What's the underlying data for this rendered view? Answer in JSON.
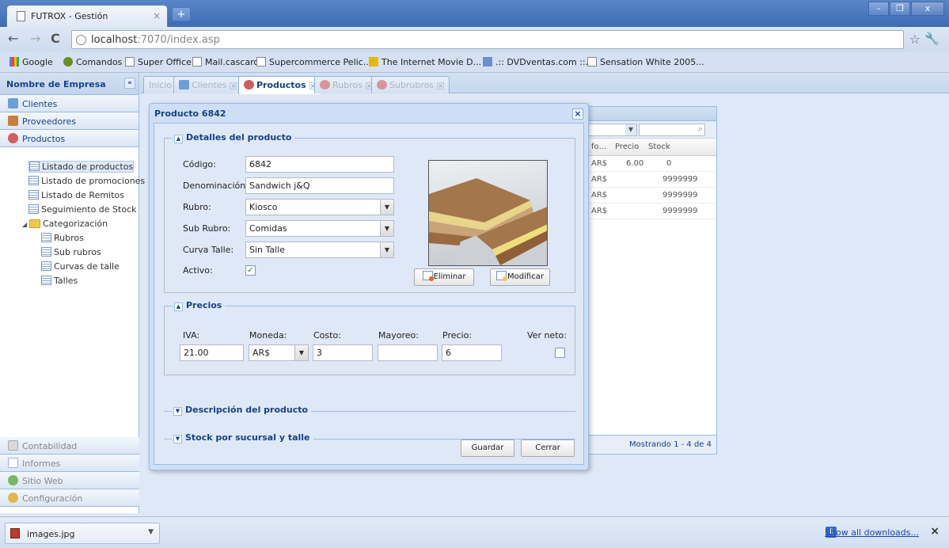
{
  "browser": {
    "tab_title": "FUTROX - Gestión",
    "tab_close": "×",
    "new_tab": "+",
    "url_host": "localhost",
    "url_rest": ":7070/index.asp",
    "window_min": "–",
    "window_max": "❐",
    "window_close": "x",
    "bookmarks": [
      "Google",
      "Comandos",
      "Super Office",
      "Mail.cascaro",
      "Supercommerce Pelic...",
      "The Internet Movie D...",
      ".:: DVDventas.com ::.",
      "Sensation White 2005..."
    ]
  },
  "sidebar": {
    "header": "Nombre de Empresa",
    "collapse": "«",
    "top_items": [
      "Clientes",
      "Proveedores",
      "Productos"
    ],
    "tree": [
      "Listado de productos",
      "Listado de promociones",
      "Listado de Remitos",
      "Seguimiento de Stock",
      "Categorización",
      "Rubros",
      "Sub rubros",
      "Curvas de talle",
      "Talles"
    ],
    "bottom_items": [
      "Contabilidad",
      "Informes",
      "Sitio Web",
      "Configuración"
    ]
  },
  "tabs": [
    "Inicio",
    "Clientes",
    "Productos",
    "Rubros",
    "Subrubros"
  ],
  "grid": {
    "headers": [
      "fo...",
      "Precio",
      "Stock"
    ],
    "rows": [
      {
        "moneda": "AR$",
        "precio": "6.00",
        "stock": "0"
      },
      {
        "moneda": "AR$",
        "precio": "",
        "stock": "9999999"
      },
      {
        "moneda": "AR$",
        "precio": "",
        "stock": "9999999"
      },
      {
        "moneda": "AR$",
        "precio": "",
        "stock": "9999999"
      }
    ],
    "footer": "Mostrando 1 - 4 de 4"
  },
  "dialog": {
    "title": "Producto 6842",
    "close": "×",
    "detalles": {
      "legend": "Detalles del producto",
      "codigo_label": "Código:",
      "codigo_value": "6842",
      "denominacion_label": "Denominación:",
      "denominacion_value": "Sandwich j&Q",
      "rubro_label": "Rubro:",
      "rubro_value": "Kiosco",
      "subrubro_label": "Sub Rubro:",
      "subrubro_value": "Comidas",
      "curva_label": "Curva Talle:",
      "curva_value": "Sin Talle",
      "activo_label": "Activo:",
      "activo_checked": true,
      "eliminar": "Eliminar",
      "modificar": "Modificar"
    },
    "precios": {
      "legend": "Precios",
      "iva_label": "IVA:",
      "iva_value": "21.00",
      "moneda_label": "Moneda:",
      "moneda_value": "AR$",
      "costo_label": "Costo:",
      "costo_value": "3",
      "mayoreo_label": "Mayoreo:",
      "mayoreo_value": "",
      "precio_label": "Precio:",
      "precio_value": "6",
      "verneto_label": "Ver neto:",
      "verneto_checked": false
    },
    "descripcion_legend": "Descripción del producto",
    "stock_legend": "Stock por sucursal y talle",
    "guardar": "Guardar",
    "cerrar": "Cerrar"
  },
  "downloads": {
    "file": "images.jpg",
    "show_all": "Show all downloads...",
    "close": "×"
  },
  "colors": {
    "ext_blue_text": "#15428b",
    "panel_bg": "#dfe8f6",
    "border": "#99bbe8"
  }
}
